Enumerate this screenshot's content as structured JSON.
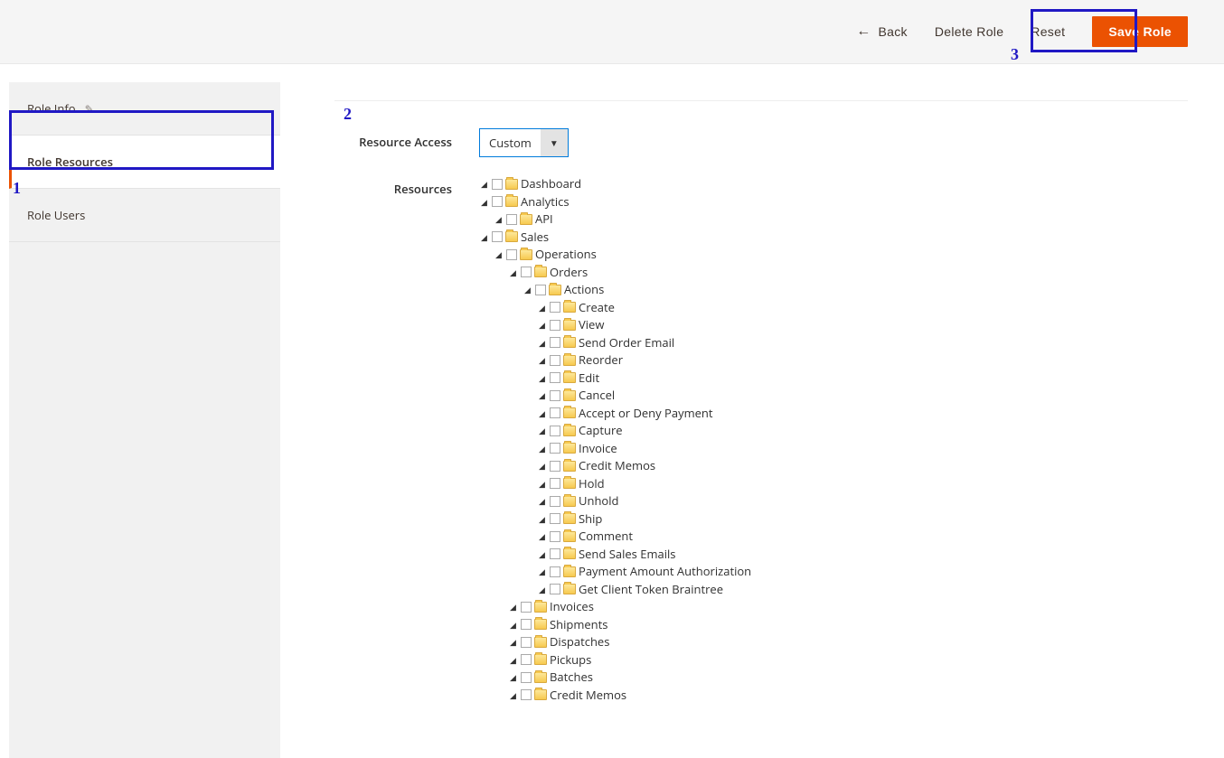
{
  "header": {
    "back": "Back",
    "delete": "Delete Role",
    "reset": "Reset",
    "save": "Save Role"
  },
  "sidebar": {
    "items": [
      {
        "label": "Role Info",
        "editable": true
      },
      {
        "label": "Role Resources",
        "active": true
      },
      {
        "label": "Role Users"
      }
    ]
  },
  "form": {
    "resource_access_label": "Resource Access",
    "resource_access_value": "Custom",
    "resources_label": "Resources"
  },
  "tree": [
    {
      "label": "Dashboard"
    },
    {
      "label": "Analytics",
      "children": [
        {
          "label": "API"
        }
      ]
    },
    {
      "label": "Sales",
      "children": [
        {
          "label": "Operations",
          "children": [
            {
              "label": "Orders",
              "children": [
                {
                  "label": "Actions",
                  "children": [
                    {
                      "label": "Create"
                    },
                    {
                      "label": "View"
                    },
                    {
                      "label": "Send Order Email"
                    },
                    {
                      "label": "Reorder"
                    },
                    {
                      "label": "Edit"
                    },
                    {
                      "label": "Cancel"
                    },
                    {
                      "label": "Accept or Deny Payment"
                    },
                    {
                      "label": "Capture"
                    },
                    {
                      "label": "Invoice"
                    },
                    {
                      "label": "Credit Memos"
                    },
                    {
                      "label": "Hold"
                    },
                    {
                      "label": "Unhold"
                    },
                    {
                      "label": "Ship"
                    },
                    {
                      "label": "Comment"
                    },
                    {
                      "label": "Send Sales Emails"
                    },
                    {
                      "label": "Payment Amount Authorization"
                    },
                    {
                      "label": "Get Client Token Braintree"
                    }
                  ]
                }
              ]
            },
            {
              "label": "Invoices"
            },
            {
              "label": "Shipments"
            },
            {
              "label": "Dispatches"
            },
            {
              "label": "Pickups"
            },
            {
              "label": "Batches"
            },
            {
              "label": "Credit Memos"
            }
          ]
        }
      ]
    }
  ],
  "annot": {
    "one": "1",
    "two": "2",
    "three": "3"
  }
}
